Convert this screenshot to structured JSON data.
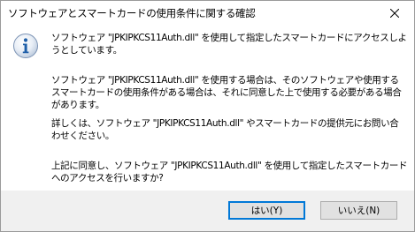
{
  "dialog": {
    "title": "ソフトウェアとスマートカードの使用条件に関する確認",
    "close_icon": "close-icon",
    "info_icon": "info-icon"
  },
  "message": {
    "p1": [
      "ソフトウェア \"JPKIPKCS11Auth.dll\" を使用して指定したスマートカードにアクセスしよ",
      "うとしています。"
    ],
    "p2": [
      "ソフトウェア \"JPKIPKCS11Auth.dll\" を使用する場合は、そのソフトウェアや使用する",
      "スマートカードの使用条件がある場合は、それに同意した上で使用する必要がある場合",
      "があります。"
    ],
    "p3": [
      "詳しくは、ソフトウェア \"JPKIPKCS11Auth.dll\" やスマートカードの提供元にお問い合",
      "わせください。"
    ],
    "p4": [
      "上記に同意し、ソフトウェア \"JPKIPKCS11Auth.dll\" を使用して指定したスマートカード",
      "へのアクセスを行いますか?"
    ]
  },
  "buttons": {
    "yes": "はい(Y)",
    "no": "いいえ(N)"
  },
  "colors": {
    "accent": "#0078d7",
    "icon_blue": "#1f5fa8"
  }
}
